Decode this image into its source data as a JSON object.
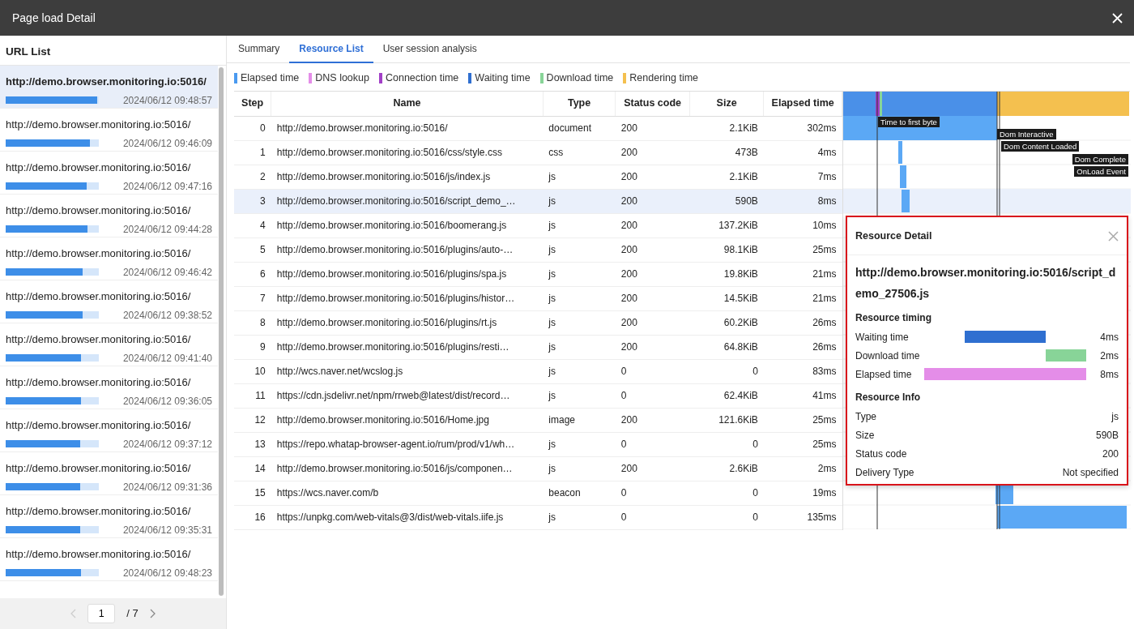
{
  "window": {
    "title": "Page load Detail"
  },
  "url_list": {
    "title": "URL List",
    "items": [
      {
        "url": "http://demo.browser.monitoring.io:5016/",
        "level": 0.98,
        "time": "2024/06/12 09:48:57",
        "selected": true
      },
      {
        "url": "http://demo.browser.monitoring.io:5016/",
        "level": 0.9,
        "time": "2024/06/12 09:46:09",
        "selected": false
      },
      {
        "url": "http://demo.browser.monitoring.io:5016/",
        "level": 0.87,
        "time": "2024/06/12 09:47:16",
        "selected": false
      },
      {
        "url": "http://demo.browser.monitoring.io:5016/",
        "level": 0.88,
        "time": "2024/06/12 09:44:28",
        "selected": false
      },
      {
        "url": "http://demo.browser.monitoring.io:5016/",
        "level": 0.83,
        "time": "2024/06/12 09:46:42",
        "selected": false
      },
      {
        "url": "http://demo.browser.monitoring.io:5016/",
        "level": 0.83,
        "time": "2024/06/12 09:38:52",
        "selected": false
      },
      {
        "url": "http://demo.browser.monitoring.io:5016/",
        "level": 0.81,
        "time": "2024/06/12 09:41:40",
        "selected": false
      },
      {
        "url": "http://demo.browser.monitoring.io:5016/",
        "level": 0.81,
        "time": "2024/06/12 09:36:05",
        "selected": false
      },
      {
        "url": "http://demo.browser.monitoring.io:5016/",
        "level": 0.8,
        "time": "2024/06/12 09:37:12",
        "selected": false
      },
      {
        "url": "http://demo.browser.monitoring.io:5016/",
        "level": 0.8,
        "time": "2024/06/12 09:31:36",
        "selected": false
      },
      {
        "url": "http://demo.browser.monitoring.io:5016/",
        "level": 0.8,
        "time": "2024/06/12 09:35:31",
        "selected": false
      },
      {
        "url": "http://demo.browser.monitoring.io:5016/",
        "level": 0.81,
        "time": "2024/06/12 09:48:23",
        "selected": false
      }
    ],
    "pagination": {
      "prev_disabled": true,
      "page": "1",
      "total": "/ 7",
      "next_disabled": false
    }
  },
  "tabs": [
    {
      "label": "Summary",
      "selected": false
    },
    {
      "label": "Resource List",
      "selected": true
    },
    {
      "label": "User session analysis",
      "selected": false
    }
  ],
  "legend": [
    {
      "label": "Elapsed time",
      "color": "#4a9af0"
    },
    {
      "label": "DNS lookup",
      "color": "#e48de8"
    },
    {
      "label": "Connection time",
      "color": "#a23fc7"
    },
    {
      "label": "Waiting time",
      "color": "#2f6fd0"
    },
    {
      "label": "Download time",
      "color": "#88d498"
    },
    {
      "label": "Rendering time",
      "color": "#f4c04f"
    }
  ],
  "table": {
    "columns": [
      "Step",
      "Name",
      "Type",
      "Status code",
      "Size",
      "Elapsed time"
    ],
    "rows": [
      {
        "step": "0",
        "name": "http://demo.browser.monitoring.io:5016/",
        "type": "document",
        "status": "200",
        "size": "2.1KiB",
        "elapsed": "302ms",
        "selected": false
      },
      {
        "step": "1",
        "name": "http://demo.browser.monitoring.io:5016/css/style.css",
        "type": "css",
        "status": "200",
        "size": "473B",
        "elapsed": "4ms",
        "selected": false
      },
      {
        "step": "2",
        "name": "http://demo.browser.monitoring.io:5016/js/index.js",
        "type": "js",
        "status": "200",
        "size": "2.1KiB",
        "elapsed": "7ms",
        "selected": false
      },
      {
        "step": "3",
        "name": "http://demo.browser.monitoring.io:5016/script_demo_…",
        "type": "js",
        "status": "200",
        "size": "590B",
        "elapsed": "8ms",
        "selected": true
      },
      {
        "step": "4",
        "name": "http://demo.browser.monitoring.io:5016/boomerang.js",
        "type": "js",
        "status": "200",
        "size": "137.2KiB",
        "elapsed": "10ms",
        "selected": false
      },
      {
        "step": "5",
        "name": "http://demo.browser.monitoring.io:5016/plugins/auto-…",
        "type": "js",
        "status": "200",
        "size": "98.1KiB",
        "elapsed": "25ms",
        "selected": false
      },
      {
        "step": "6",
        "name": "http://demo.browser.monitoring.io:5016/plugins/spa.js",
        "type": "js",
        "status": "200",
        "size": "19.8KiB",
        "elapsed": "21ms",
        "selected": false
      },
      {
        "step": "7",
        "name": "http://demo.browser.monitoring.io:5016/plugins/histor…",
        "type": "js",
        "status": "200",
        "size": "14.5KiB",
        "elapsed": "21ms",
        "selected": false
      },
      {
        "step": "8",
        "name": "http://demo.browser.monitoring.io:5016/plugins/rt.js",
        "type": "js",
        "status": "200",
        "size": "60.2KiB",
        "elapsed": "26ms",
        "selected": false
      },
      {
        "step": "9",
        "name": "http://demo.browser.monitoring.io:5016/plugins/resti…",
        "type": "js",
        "status": "200",
        "size": "64.8KiB",
        "elapsed": "26ms",
        "selected": false
      },
      {
        "step": "10",
        "name": "http://wcs.naver.net/wcslog.js",
        "type": "js",
        "status": "0",
        "size": "0",
        "elapsed": "83ms",
        "selected": false
      },
      {
        "step": "11",
        "name": "https://cdn.jsdelivr.net/npm/rrweb@latest/dist/record…",
        "type": "js",
        "status": "0",
        "size": "62.4KiB",
        "elapsed": "41ms",
        "selected": false
      },
      {
        "step": "12",
        "name": "http://demo.browser.monitoring.io:5016/Home.jpg",
        "type": "image",
        "status": "200",
        "size": "121.6KiB",
        "elapsed": "25ms",
        "selected": false
      },
      {
        "step": "13",
        "name": "https://repo.whatap-browser-agent.io/rum/prod/v1/wh…",
        "type": "js",
        "status": "0",
        "size": "0",
        "elapsed": "25ms",
        "selected": false
      },
      {
        "step": "14",
        "name": "http://demo.browser.monitoring.io:5016/js/componen…",
        "type": "js",
        "status": "200",
        "size": "2.6KiB",
        "elapsed": "2ms",
        "selected": false
      },
      {
        "step": "15",
        "name": "https://wcs.naver.com/b",
        "type": "beacon",
        "status": "0",
        "size": "0",
        "elapsed": "19ms",
        "selected": false
      },
      {
        "step": "16",
        "name": "https://unpkg.com/web-vitals@3/dist/web-vitals.iife.js",
        "type": "js",
        "status": "0",
        "size": "0",
        "elapsed": "135ms",
        "selected": false
      }
    ]
  },
  "waterfall": {
    "markers": [
      "Time to first byte",
      "Dom Interactive",
      "Dom Content Loaded",
      "Dom Complete",
      "OnLoad Event"
    ]
  },
  "resource_detail": {
    "title": "Resource Detail",
    "url": "http://demo.browser.monitoring.io:5016/script_demo_27506.js",
    "timing_title": "Resource timing",
    "timing": [
      {
        "kind": "waiting",
        "label": "Waiting time",
        "value": "4ms",
        "color": "#2f6fd0"
      },
      {
        "kind": "download",
        "label": "Download time",
        "value": "2ms",
        "color": "#88d498"
      },
      {
        "kind": "total",
        "label": "Elapsed time",
        "value": "8ms",
        "color": "#e48de8"
      }
    ],
    "info_title": "Resource Info",
    "info": [
      {
        "label": "Type",
        "value": "js"
      },
      {
        "label": "Size",
        "value": "590B"
      },
      {
        "label": "Status code",
        "value": "200"
      },
      {
        "label": "Delivery Type",
        "value": "Not specified"
      }
    ]
  }
}
